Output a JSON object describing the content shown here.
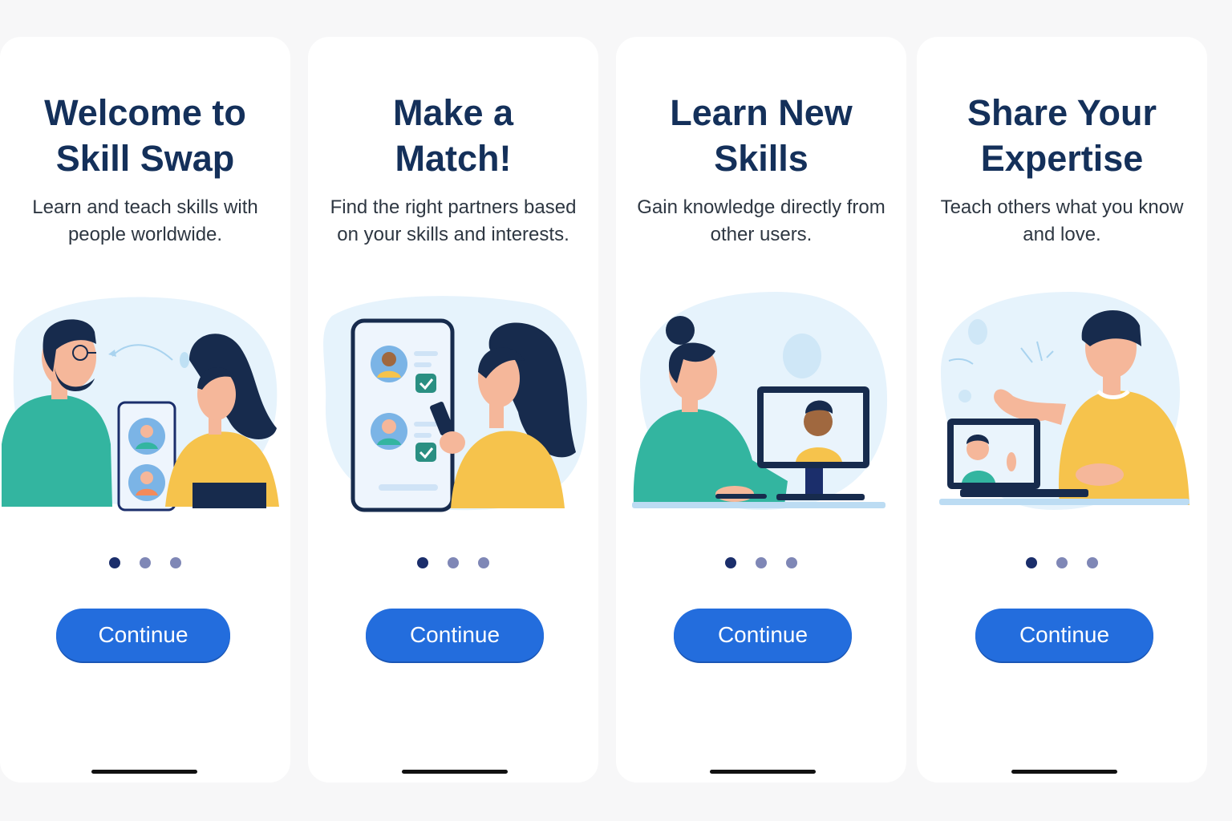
{
  "screens": [
    {
      "title_line1": "Welcome to",
      "title_line2": "Skill Swap",
      "subtitle": "Learn and teach skills with people worldwide.",
      "button_label": "Continue",
      "illustration": "two-people-exchanging-profiles",
      "active_dot": 1,
      "dot_count": 3
    },
    {
      "title_line1": "Make a",
      "title_line2": "Match!",
      "subtitle": "Find the right partners based on your skills and interests.",
      "button_label": "Continue",
      "illustration": "woman-matching-on-phone",
      "active_dot": 1,
      "dot_count": 3
    },
    {
      "title_line1": "Learn New",
      "title_line2": "Skills",
      "subtitle": "Gain knowledge directly from other users.",
      "button_label": "Continue",
      "illustration": "woman-video-call-on-computer",
      "active_dot": 1,
      "dot_count": 3
    },
    {
      "title_line1": "Share Your",
      "title_line2": "Expertise",
      "subtitle": "Teach others what you know and love.",
      "button_label": "Continue",
      "illustration": "man-teaching-via-laptop",
      "active_dot": 1,
      "dot_count": 3
    }
  ],
  "colors": {
    "title": "#14305a",
    "button": "#236ddd",
    "dot_active": "#1b2e6b",
    "dot_inactive": "#7f87b6",
    "teal": "#33b5a0",
    "yellow": "#f6c34c",
    "navy": "#172b4d",
    "skin": "#f5b79a",
    "blob": "#e6f3fc"
  }
}
